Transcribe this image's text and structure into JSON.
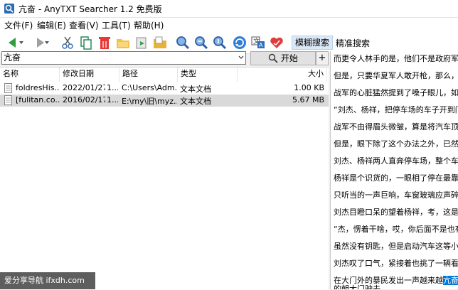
{
  "window": {
    "title": "亢奋 - AnyTXT Searcher 1.2 免费版"
  },
  "menu": [
    "文件(F)",
    "编辑(E)",
    "查看(V)",
    "工具(T)",
    "帮助(H)"
  ],
  "toolbar": {
    "tabs": [
      "模糊搜索",
      "精准搜索"
    ],
    "active_tab": "模糊搜索"
  },
  "search": {
    "value": "亢奋",
    "start_label": "开始",
    "plus_label": "+"
  },
  "columns": [
    "名称",
    "修改日期",
    "路径",
    "类型",
    "大小"
  ],
  "rows": [
    {
      "name": "foldresHis...",
      "date": "2022/01/27",
      "time": "1...",
      "path": "C:\\Users\\Adm...",
      "type": "文本文档",
      "size": "1.00 KB",
      "selected": false
    },
    {
      "name": "[fulitan.co...",
      "date": "2016/02/17",
      "time": "1...",
      "path": "E:\\my\\旧\\myz...",
      "type": "文本文档",
      "size": "5.67 MB",
      "selected": true
    }
  ],
  "preview": {
    "lines": [
      "而更令人林手的是，他们不是政府军，甚",
      "但是，只要华夏军人敢开枪，那么，事情",
      "战军的心脏猛然提到了嗓子眼儿，如果大",
      "“刘杰、杨祥，把停车场的车子开到门口",
      "战军不由得眉头微皱，算是将汽车顶在大",
      "但是，眼下除了这个办法之外，已然再没",
      "刘杰、杨祥两人直奔停车场，整个车库停",
      "杨祥是个识货的，一眼相了停在最靠边的",
      "只听当的一声巨响，车窗玻璃应声碎成了",
      "刘杰目瞪口呆的望着杨祥，考，这是路虎",
      "“杰，愣着干啥，哎，你后面不是也有一",
      "虽然没有钥匙，但是启动汽车这等小活儿",
      "刘杰叹了口气，紧接着也挑了一辆看着较",
      "在大门外的暴民发出一声越来越",
      "的朝大门驶去。"
    ],
    "highlight": "亢奋",
    "highlight_tail": "的"
  },
  "watermark": "爱分享导航 ifxdh.com"
}
